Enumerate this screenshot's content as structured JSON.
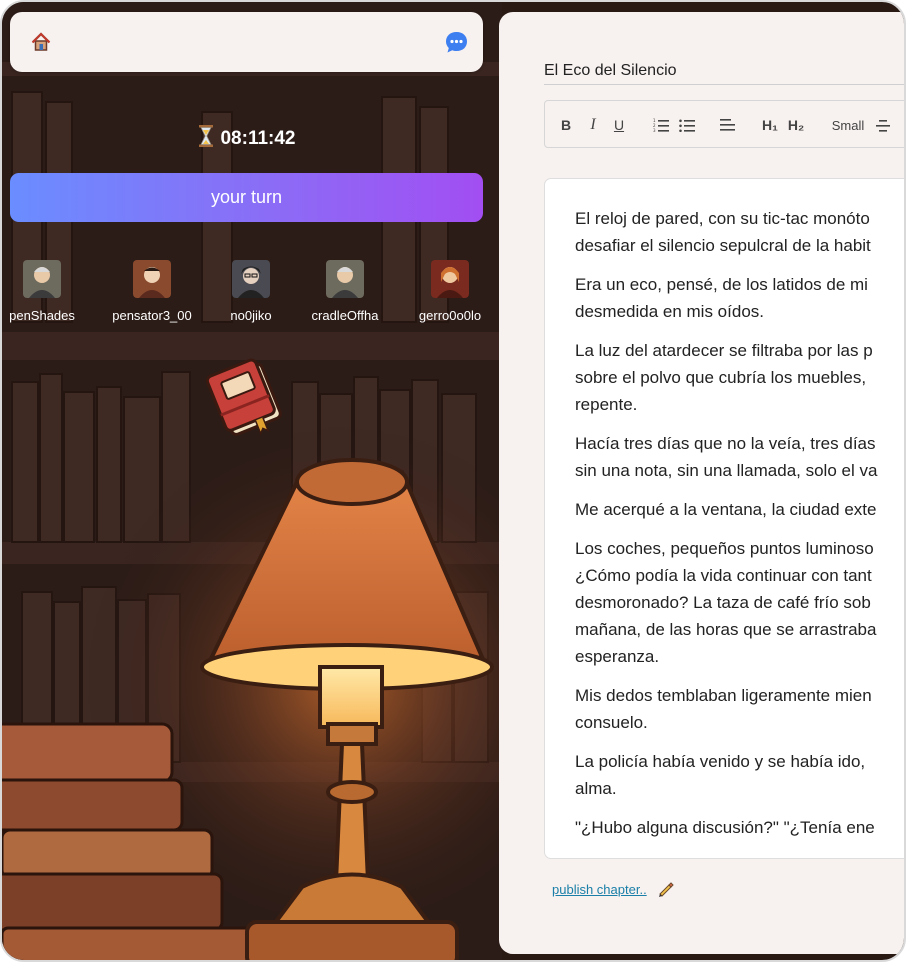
{
  "header": {
    "home_icon": "home-icon",
    "chat_icon": "chat-bubble-icon"
  },
  "timer": {
    "icon": "hourglass-icon",
    "value": "08:11:42"
  },
  "turn_button": {
    "label": "your turn",
    "gradient": [
      "#6a8dff",
      "#a24ef2"
    ]
  },
  "players": [
    {
      "name": "penShades"
    },
    {
      "name": "pensator3_00"
    },
    {
      "name": "no0jiko"
    },
    {
      "name": "cradleOffha"
    },
    {
      "name": "gerro0o0lo"
    }
  ],
  "editor": {
    "title": "El Eco del Silencio",
    "toolbar": {
      "bold": "B",
      "italic": "I",
      "underline": "U",
      "h1": "H₁",
      "h2": "H₂",
      "small": "Small"
    },
    "paragraphs": [
      "El reloj de pared, con su tic-tac monóto\ndesafiar el silencio sepulcral de la habit",
      "Era un eco, pensé, de los latidos de mi \ndesmedida en mis oídos.",
      "La luz del atardecer se filtraba por las p\nsobre el polvo que cubría los muebles, \nrepente.",
      "Hacía tres días que no la veía, tres días\nsin una nota, sin una llamada, solo el va",
      "Me acerqué a la ventana, la ciudad exte",
      "Los coches, pequeños puntos luminoso\n¿Cómo podía la vida continuar con tant\ndesmoronado? La taza de café frío sob\nmañana, de las horas que se arrastraba\nesperanza.",
      "Mis dedos temblaban ligeramente mien\nconsuelo.",
      "La policía había venido y se había ido, \nalma.",
      "\"¿Hubo alguna discusión?\" \"¿Tenía ene"
    ]
  },
  "publish": {
    "label": "publish chapter..",
    "icon": "pen-icon"
  },
  "colors": {
    "panel_bg": "#f7f1ef",
    "link": "#1a7fa8",
    "scene_dark": "#2a1a14",
    "lamp_glow": "#f0a050"
  }
}
